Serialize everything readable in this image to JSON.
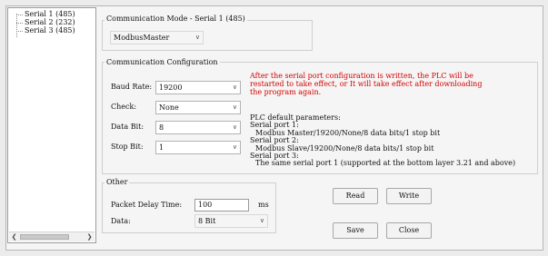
{
  "tree": {
    "items": [
      {
        "label": "Serial 1 (485)"
      },
      {
        "label": "Serial 2 (232)"
      },
      {
        "label": "Serial 3 (485)"
      }
    ],
    "scroll_left_icon": "chevron-left-icon",
    "scroll_right_icon": "chevron-right-icon"
  },
  "mode": {
    "title": "Communication Mode - Serial 1 (485)",
    "value": "ModbusMaster"
  },
  "config": {
    "title": "Communication Configuration",
    "baud_label": "Baud Rate:",
    "baud_value": "19200",
    "check_label": "Check:",
    "check_value": "None",
    "databit_label": "Data Bit:",
    "databit_value": "8",
    "stopbit_label": "Stop Bit:",
    "stopbit_value": "1",
    "warning": [
      "After the serial port configuration is written, the PLC will be",
      "restarted to take effect, or It will take effect after downloading",
      "the program again."
    ],
    "params": [
      "PLC default parameters:",
      "Serial port 1:",
      "Modbus Master/19200/None/8 data bits/1 stop bit",
      "Serial port 2:",
      "Modbus Slave/19200/None/8 data bits/1 stop bit",
      "Serial port 3:",
      "The same serial port 1 (supported at the bottom layer 3.21 and above)"
    ]
  },
  "other": {
    "title": "Other",
    "delay_label": "Packet Delay Time:",
    "delay_value": "100",
    "delay_unit": "ms",
    "data_label": "Data:",
    "data_value": "8 Bit"
  },
  "buttons": {
    "read": "Read",
    "write": "Write",
    "save": "Save",
    "close": "Close"
  }
}
